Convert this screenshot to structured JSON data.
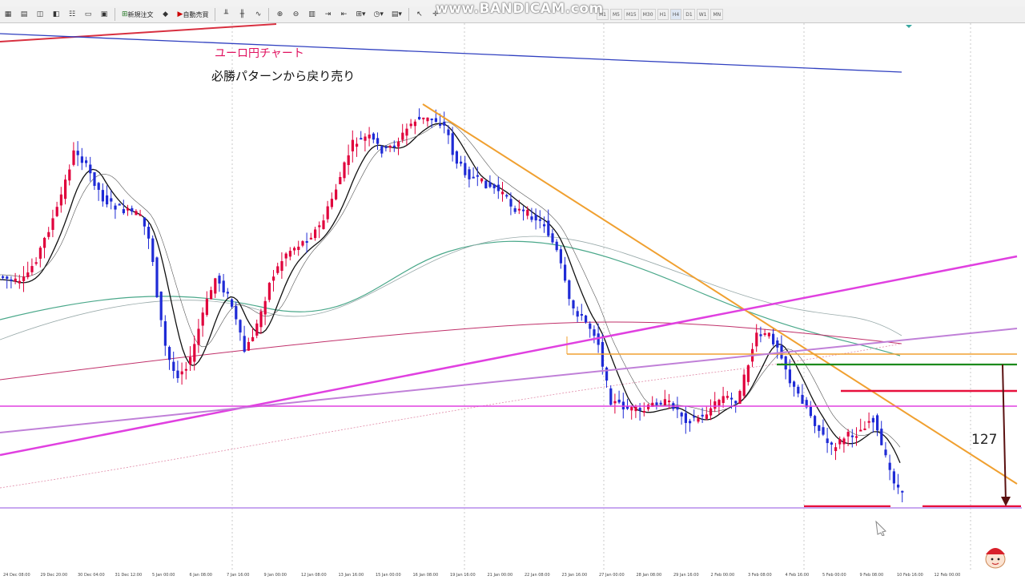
{
  "toolbar": {
    "new_order_label": "新規注文",
    "auto_trade_label": "自動売買",
    "timeframes": [
      "M1",
      "M5",
      "M15",
      "M30",
      "H1",
      "H4",
      "D1",
      "W1",
      "MN"
    ]
  },
  "watermark": "www.BANDICAM.com",
  "annotations": {
    "title": "ユーロ円チャート",
    "subtitle": "必勝パターンから戻り売り",
    "pips_label": "127"
  },
  "time_axis": [
    "24 Dec 08:00",
    "29 Dec 20:00",
    "30 Dec 04:00",
    "31 Dec 12:00",
    "5 Jan 00:00",
    "6 Jan 08:00",
    "7 Jan 16:00",
    "9 Jan 00:00",
    "12 Jan 08:00",
    "13 Jan 16:00",
    "15 Jan 00:00",
    "16 Jan 08:00",
    "19 Jan 16:00",
    "21 Jan 00:00",
    "22 Jan 08:00",
    "23 Jan 16:00",
    "27 Jan 00:00",
    "28 Jan 08:00",
    "29 Jan 16:00",
    "2 Feb 00:00",
    "3 Feb 08:00",
    "4 Feb 16:00",
    "5 Feb 00:00",
    "9 Feb 08:00",
    "10 Feb 16:00",
    "12 Feb 00:00"
  ],
  "colors": {
    "bull": "#e0003c",
    "bear": "#1f2bd6",
    "trend_orange": "#f0a030",
    "magenta": "#e040e0",
    "green": "#1c8a1c",
    "red_level": "#e8103c"
  }
}
